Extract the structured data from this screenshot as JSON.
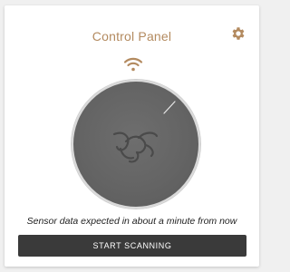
{
  "panel": {
    "title": "Control Panel",
    "settings_icon": "gear-icon",
    "connection_icon": "wifi-icon",
    "dial_icon": "logo-mark-icon"
  },
  "status": {
    "message": "Sensor data expected in about a minute from now"
  },
  "actions": {
    "scan_label": "START SCANNING"
  },
  "colors": {
    "accent": "#b38a5f",
    "button_bg": "#3a3a3a",
    "dial_bg": "#666666"
  }
}
